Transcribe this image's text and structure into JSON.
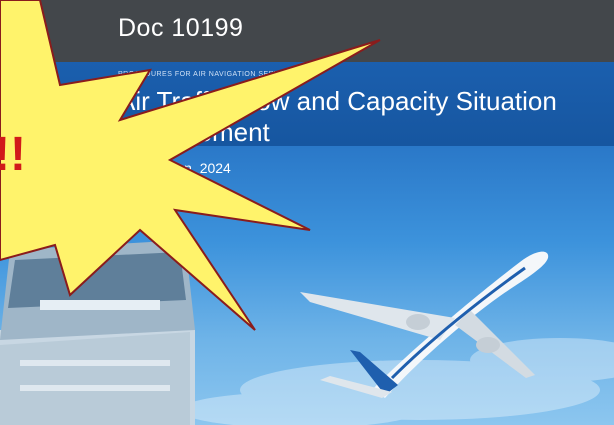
{
  "header": {
    "doc_number": "Doc 10199"
  },
  "banner": {
    "procedures_line": "PROCEDURES FOR AIR NAVIGATION SERVICES",
    "title": "Air Traffic Flow and Capacity Situation Management"
  },
  "edition": "First Edition, 2024",
  "starburst": {
    "text": "!!",
    "fill": "#fff36b",
    "stroke": "#8a1c1c",
    "text_color": "#d11a1a"
  },
  "colors": {
    "top_bar": "#43474b",
    "blue_banner": "#1b5fae"
  },
  "icons": [
    "control-tower-icon",
    "airplane-icon"
  ]
}
